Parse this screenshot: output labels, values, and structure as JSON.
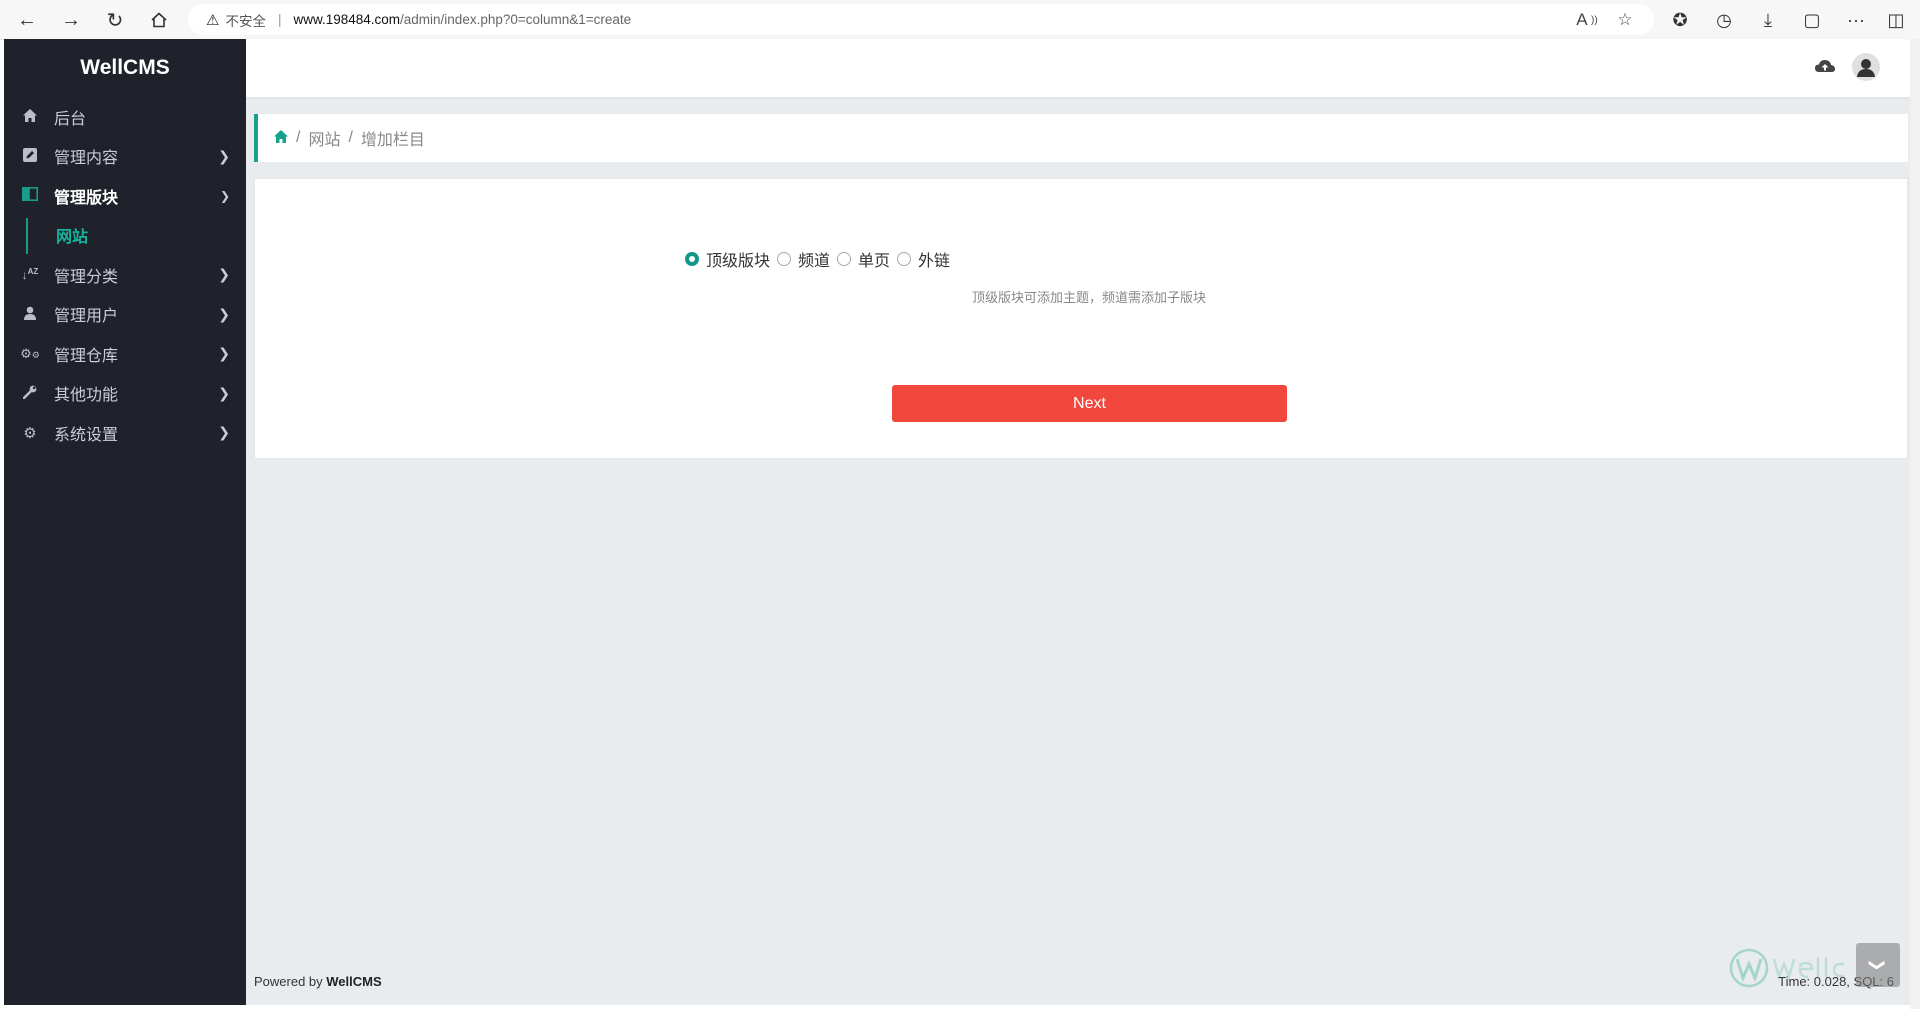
{
  "browser": {
    "insecure_label": "不安全",
    "url": "www.198484.com/admin/index.php?0=column&1=create",
    "url_domain": "www.198484.com",
    "url_path": "/admin/index.php?0=column&1=create"
  },
  "sidebar": {
    "brand": "WellCMS",
    "items": [
      {
        "label": "后台",
        "icon": "home-icon",
        "has_chevron": false
      },
      {
        "label": "管理内容",
        "icon": "edit-icon",
        "has_chevron": true
      },
      {
        "label": "管理版块",
        "icon": "columns-icon",
        "has_chevron": true,
        "active": true,
        "expanded": true
      },
      {
        "label": "管理分类",
        "icon": "sort-icon",
        "has_chevron": true
      },
      {
        "label": "管理用户",
        "icon": "user-icon",
        "has_chevron": true
      },
      {
        "label": "管理仓库",
        "icon": "cogs-icon",
        "has_chevron": true
      },
      {
        "label": "其他功能",
        "icon": "wrench-icon",
        "has_chevron": true
      },
      {
        "label": "系统设置",
        "icon": "gear-icon",
        "has_chevron": true
      }
    ],
    "submenu": {
      "label": "网站"
    }
  },
  "breadcrumb": {
    "items": [
      "网站",
      "增加栏目"
    ]
  },
  "form": {
    "radio_options": [
      {
        "label": "顶级版块",
        "checked": true
      },
      {
        "label": "频道",
        "checked": false
      },
      {
        "label": "单页",
        "checked": false
      },
      {
        "label": "外链",
        "checked": false
      }
    ],
    "hint": "顶级版块可添加主题，频道需添加子版块",
    "next_label": "Next"
  },
  "footer": {
    "powered_prefix": "Powered by ",
    "powered_brand": "WellCMS",
    "time_text": "Time: 0.028, SQL: 6"
  },
  "colors": {
    "accent": "#17a08c",
    "next_button": "#f1473c",
    "sidebar_bg": "#1f222b",
    "main_bg": "#e9ecef"
  }
}
